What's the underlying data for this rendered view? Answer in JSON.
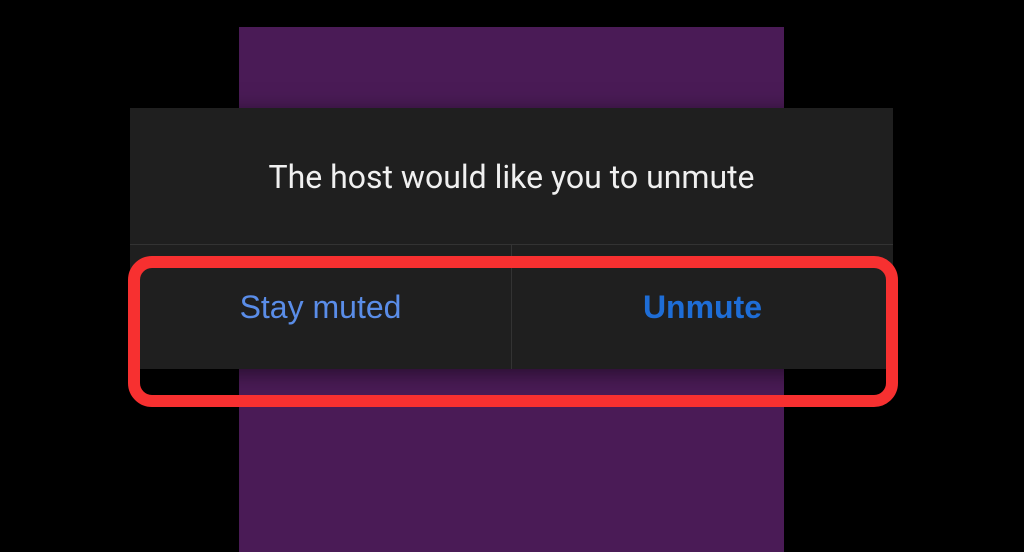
{
  "dialog": {
    "message": "The host would like you to unmute",
    "actions": {
      "stay_muted_label": "Stay muted",
      "unmute_label": "Unmute"
    }
  }
}
